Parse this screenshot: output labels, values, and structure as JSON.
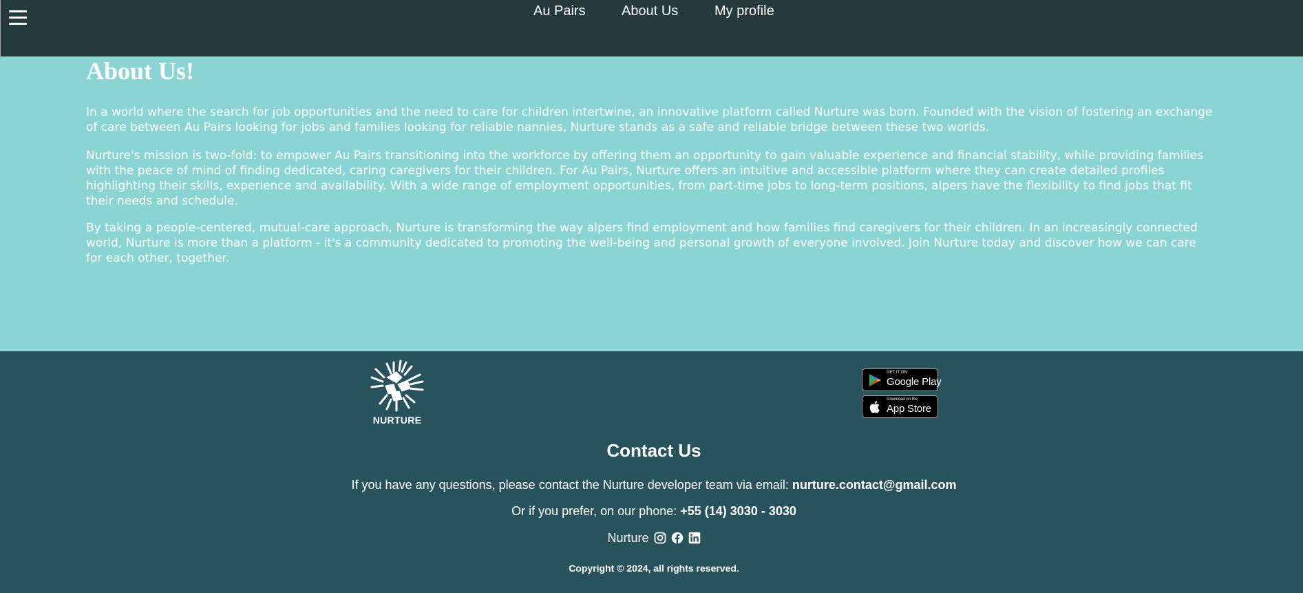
{
  "nav": {
    "menu_icon": "hamburger-menu-icon",
    "links": [
      {
        "label": "Au Pairs"
      },
      {
        "label": "About Us"
      },
      {
        "label": "My profile"
      }
    ]
  },
  "main": {
    "title": "About Us!",
    "paragraphs": [
      "In a world where the search for job opportunities and the need to care for children intertwine, an innovative platform called Nurture was born. Founded with the vision of fostering an exchange of care between Au Pairs looking for jobs and families looking for reliable nannies, Nurture stands as a safe and reliable bridge between these two worlds.",
      "Nurture's mission is two-fold: to empower Au Pairs transitioning into the workforce by offering them an opportunity to gain valuable experience and financial stability, while providing families with the peace of mind of finding dedicated, caring caregivers for their children. For Au Pairs, Nurture offers an intuitive and accessible platform where they can create detailed profiles highlighting their skills, experience and availability. With a wide range of employment opportunities, from part-time jobs to long-term positions, alpers have the flexibility to find jobs that fit their needs and schedule.",
      "By taking a people-centered, mutual-care approach, Nurture is transforming the way alpers find employment and how families find caregivers for their children. In an increasingly connected world, Nurture is more than a platform - it's a community dedicated to promoting the well-being and personal growth of everyone involved. Join Nurture today and discover how we can care for each other, together."
    ]
  },
  "footer": {
    "logo_text": "NURTURE",
    "google_play": {
      "small": "GET IT ON",
      "big": "Google Play"
    },
    "app_store": {
      "small": "Download on the",
      "big": "App Store"
    },
    "contact_title": "Contact Us",
    "email_prefix": "If you have any questions, please contact the Nurture developer team via email: ",
    "email": "nurture.contact@gmail.com",
    "phone_prefix": "Or if you prefer, on our phone: ",
    "phone": "+55 (14) 3030 - 3030",
    "social_brand": "Nurture",
    "social_icons": [
      "instagram-icon",
      "facebook-icon",
      "linkedin-icon"
    ],
    "copyright": "Copyright © 2024, all rights reserved."
  },
  "colors": {
    "header_bg": "#243a3b",
    "main_bg": "#8ad4d3",
    "footer_bg": "#28525c",
    "text": "#ffffff"
  }
}
